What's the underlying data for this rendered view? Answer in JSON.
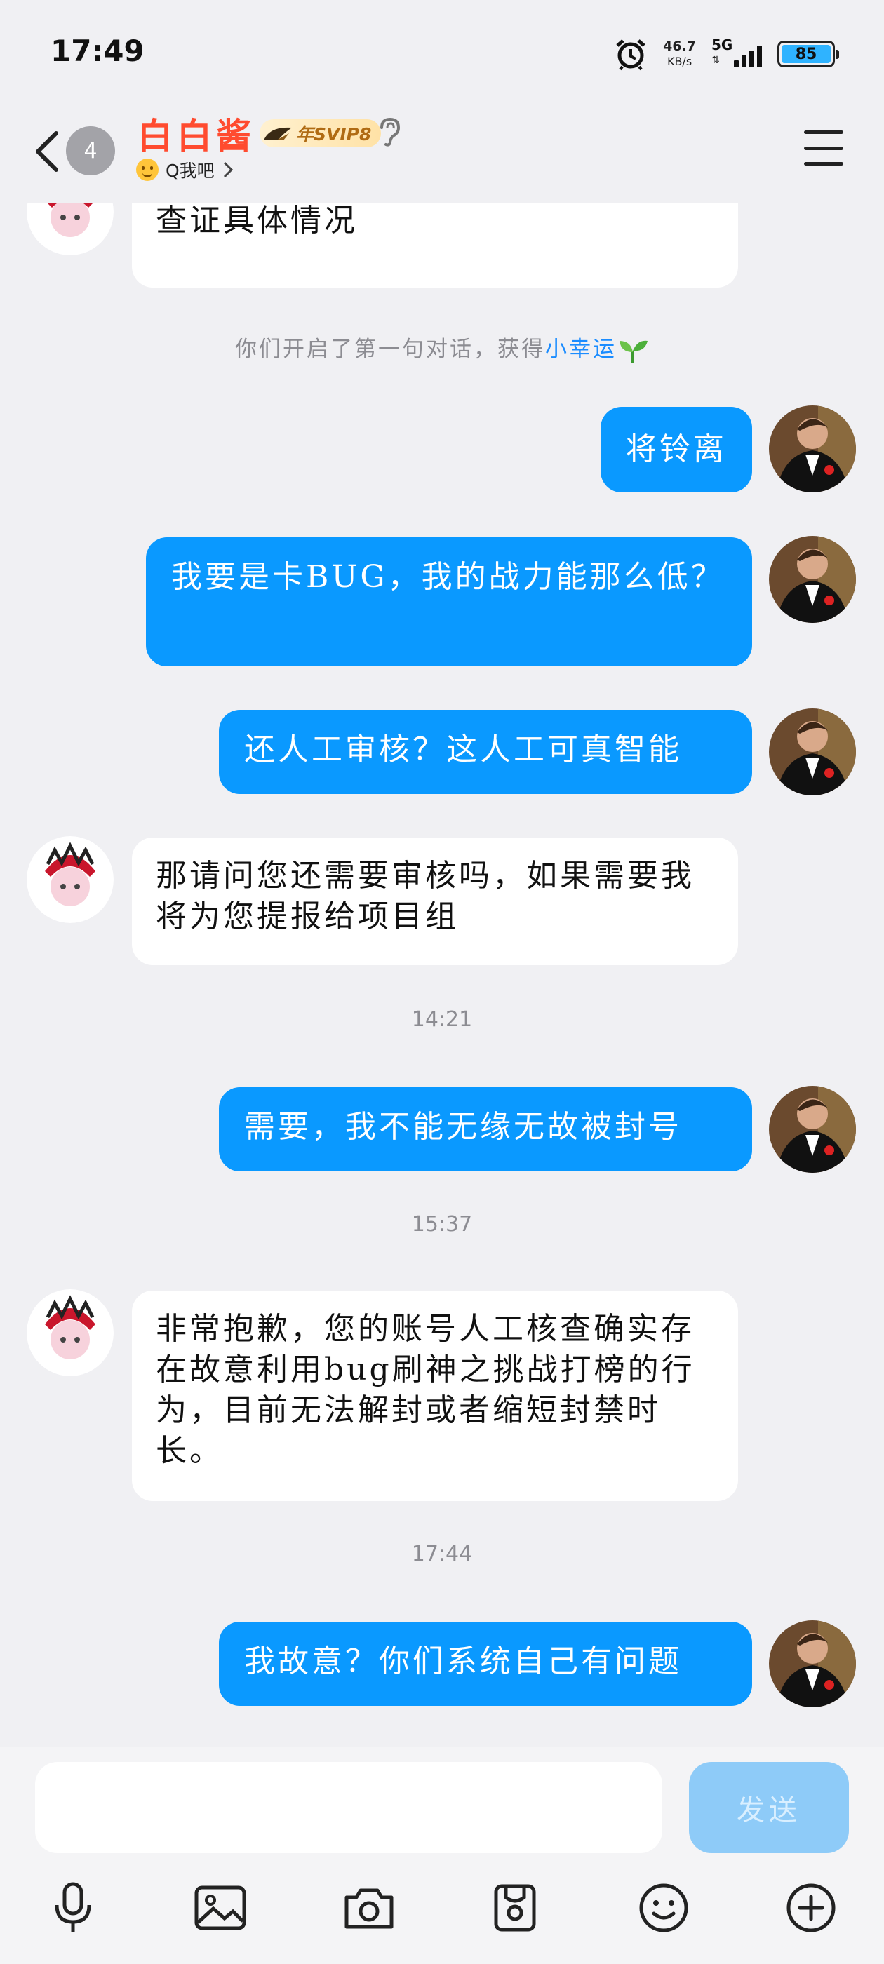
{
  "status_bar": {
    "time": "17:49",
    "net_speed": "46.7",
    "net_unit": "KB/s",
    "network_type": "5G",
    "battery": "85",
    "icons": [
      "alarm-icon",
      "signal-icon",
      "battery-icon"
    ]
  },
  "header": {
    "unread_count": "4",
    "contact_name": "白白酱",
    "vip_label": "年SVIP8",
    "status_text": "Q我吧",
    "icons": [
      "back-chevron-icon",
      "ear-icon",
      "smile-emoji-icon",
      "chevron-right-icon",
      "menu-icon"
    ]
  },
  "messages": [
    {
      "side": "in",
      "text": "请提供下您的uid或者角色名称我们查证具体情况",
      "partially_visible": true
    },
    {
      "type": "system",
      "text": "你们开启了第一句对话，获得",
      "highlight": "小幸运"
    },
    {
      "side": "out",
      "text": "将铃离"
    },
    {
      "side": "out",
      "text": "我要是卡BUG，我的战力能那么低？"
    },
    {
      "side": "out",
      "text": "还人工审核？这人工可真智能"
    },
    {
      "side": "in",
      "text": "那请问您还需要审核吗，如果需要我将为您提报给项目组"
    },
    {
      "type": "time",
      "text": "14:21"
    },
    {
      "side": "out",
      "text": "需要，我不能无缘无故被封号"
    },
    {
      "type": "time",
      "text": "15:37"
    },
    {
      "side": "in",
      "text": "非常抱歉，您的账号人工核查确实存在故意利用bug刷神之挑战打榜的行为，目前无法解封或者缩短封禁时长。"
    },
    {
      "type": "time",
      "text": "17:44"
    },
    {
      "side": "out",
      "text": "我故意？你们系统自己有问题"
    }
  ],
  "input": {
    "placeholder": "",
    "send_label": "发送"
  },
  "toolbar": [
    "microphone-icon",
    "image-icon",
    "camera-icon",
    "sticker-icon",
    "emoji-icon",
    "plus-icon"
  ],
  "colors": {
    "outgoing_bubble": "#0a99ff",
    "incoming_bubble": "#ffffff",
    "background": "#f0f0f3",
    "name": "#ff4b2f",
    "send_button": "#8ecbf8"
  }
}
